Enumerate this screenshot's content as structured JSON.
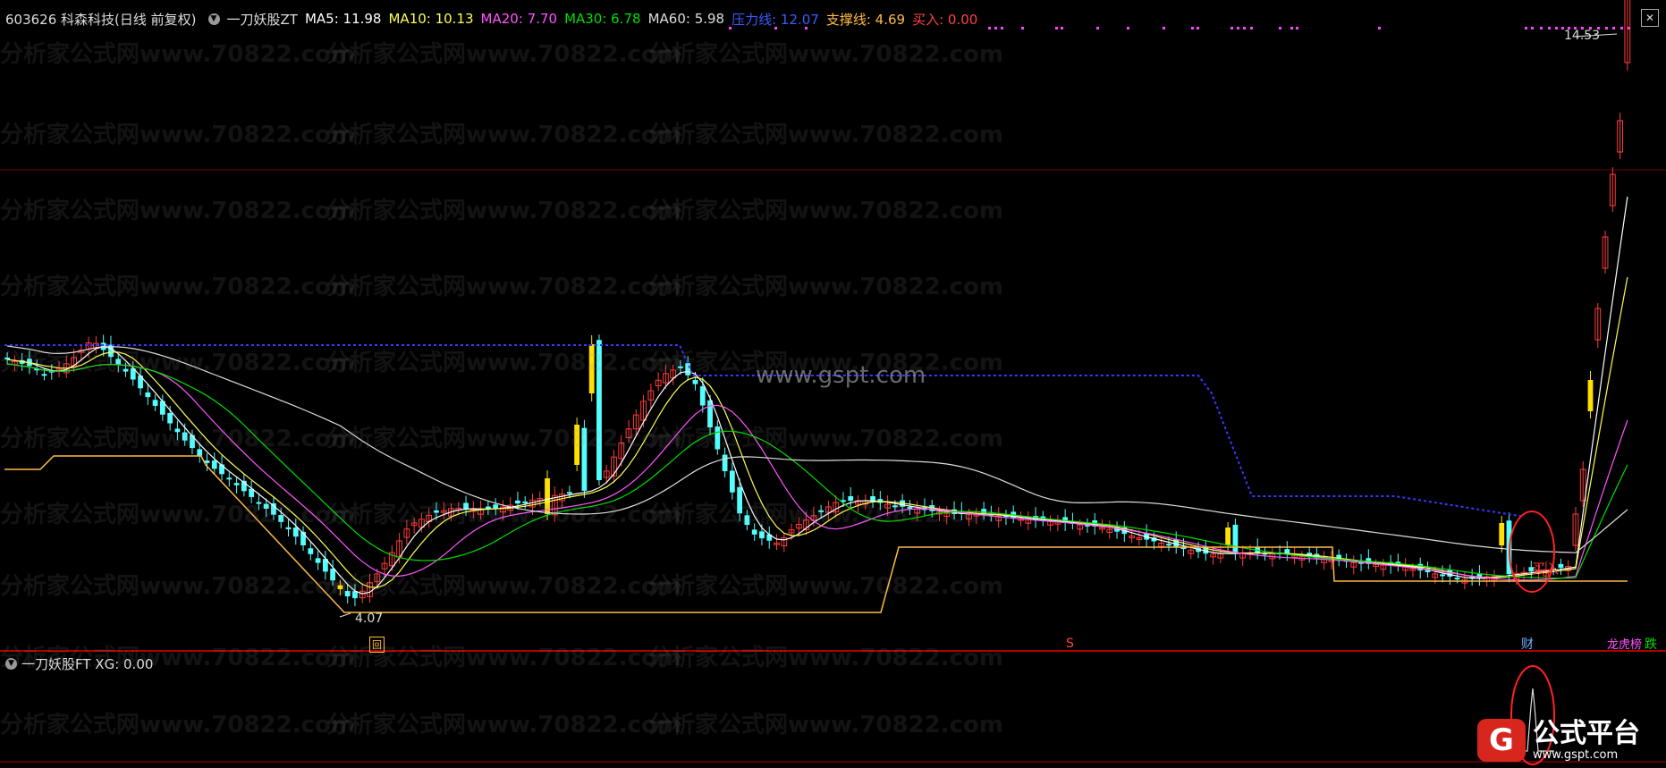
{
  "header": {
    "code_name": "603626 科森科技(日线 前复权)",
    "indicator": "一刀妖股ZT",
    "ma5": "MA5: 11.98",
    "ma10": "MA10: 10.13",
    "ma20": "MA20: 7.70",
    "ma30": "MA30: 6.78",
    "ma60": "MA60: 5.98",
    "pressure": "压力线: 12.07",
    "support": "支撑线: 4.69",
    "buy": "买入: 0.00",
    "close_symbol": "✕"
  },
  "sub_header": {
    "label": "一刀妖股FT XG: 0.00"
  },
  "annotations": {
    "high_label": "14.53",
    "low_label": "4.07",
    "buy_marker": "买入",
    "event_s": "S",
    "event_cai": "财",
    "event_bang": "龙虎榜",
    "event_die": "跌",
    "event_box": "回"
  },
  "watermark": {
    "text": "分析家公式网www.70822.com",
    "site": "www.gspt.com"
  },
  "logo": {
    "glyph": "G",
    "title": "公式平台",
    "url": "www.gspt.com"
  },
  "colors": {
    "up": "#ff3b3b",
    "down": "#54ffff",
    "limit": "#ffe000",
    "ma5": "#ffffff",
    "ma10": "#ffff55",
    "ma20": "#ff55ff",
    "ma30": "#00dd00",
    "ma60": "#dddddd",
    "pressure": "#3838ff",
    "support": "#ffbb44",
    "buy": "#ff4444",
    "separator": "#b00000"
  },
  "chart_data": {
    "type": "candlestick",
    "title": "603626 科森科技(日线 前复权)",
    "price_range": [
      4.07,
      14.53
    ],
    "series_names": [
      "MA5",
      "MA10",
      "MA20",
      "MA30",
      "MA60",
      "压力线",
      "支撑线"
    ],
    "last_values": {
      "MA5": 11.98,
      "MA10": 10.13,
      "MA20": 7.7,
      "MA30": 6.78,
      "MA60": 5.98,
      "压力线": 12.07,
      "支撑线": 4.69,
      "买入": 0.0
    },
    "sub_indicator": {
      "name": "一刀妖股FT",
      "XG": 0.0
    }
  }
}
